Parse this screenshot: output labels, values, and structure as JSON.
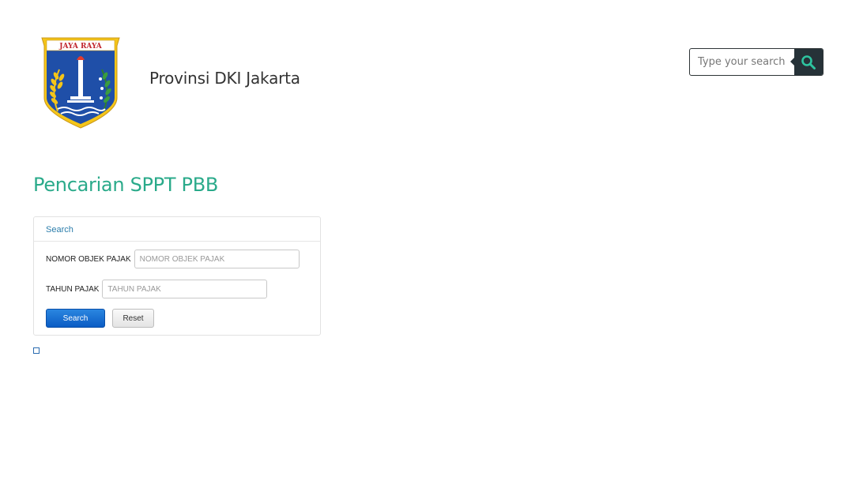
{
  "header": {
    "site_title": "Provinsi DKI Jakarta",
    "logo_banner_text": "JAYA RAYA",
    "search": {
      "placeholder": "Type your search",
      "value": ""
    }
  },
  "main": {
    "page_title": "Pencarian SPPT PBB",
    "panel": {
      "heading": "Search",
      "fields": [
        {
          "label": "NOMOR OBJEK PAJAK",
          "placeholder": "NOMOR OBJEK PAJAK",
          "value": ""
        },
        {
          "label": "TAHUN PAJAK",
          "placeholder": "TAHUN PAJAK",
          "value": ""
        }
      ],
      "search_button": "Search",
      "reset_button": "Reset"
    }
  },
  "icons": {
    "search": "search-icon",
    "logo": "dki-jakarta-emblem"
  },
  "colors": {
    "title_green": "#2aaa8a",
    "search_button_dark": "#263238",
    "search_icon_teal": "#2ec4a0",
    "primary_button_blue": "#0b5cc4",
    "panel_heading_blue": "#2b7dab"
  }
}
